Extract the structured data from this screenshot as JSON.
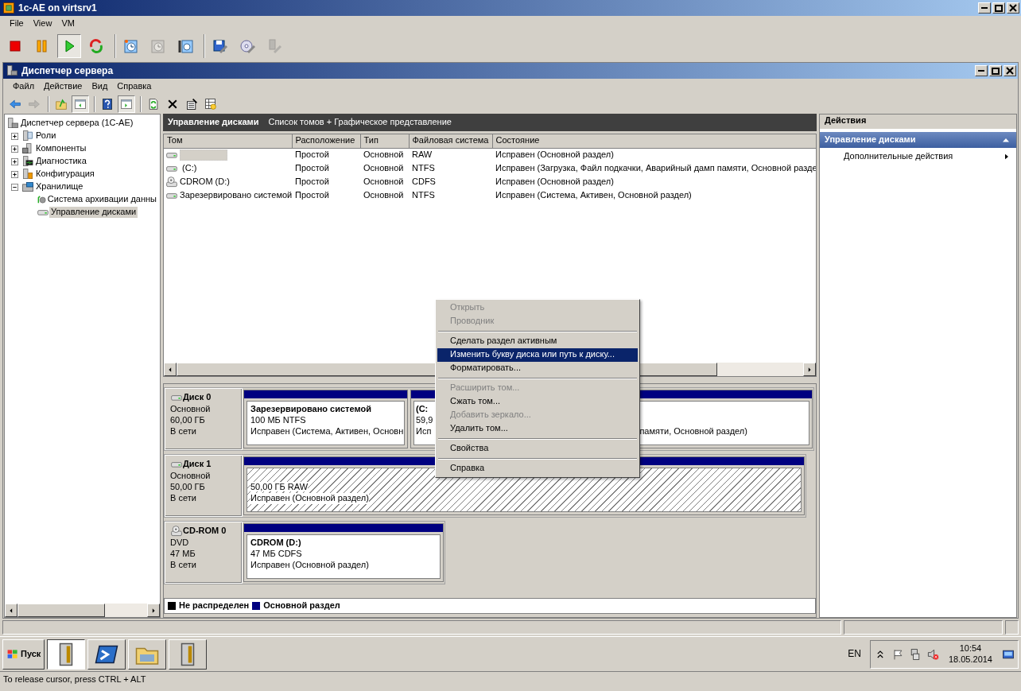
{
  "vm_window": {
    "title": "1c-AE on virtsrv1",
    "menu": [
      "File",
      "View",
      "VM"
    ],
    "toolbar": [
      {
        "kind": "stop",
        "disabled": false,
        "pressed": false
      },
      {
        "kind": "pause",
        "disabled": false,
        "pressed": false
      },
      {
        "kind": "play",
        "disabled": false,
        "pressed": true
      },
      {
        "kind": "reset",
        "disabled": false,
        "pressed": false
      },
      {
        "kind": "separator"
      },
      {
        "kind": "snapshot",
        "disabled": false,
        "pressed": false
      },
      {
        "kind": "revert",
        "disabled": true,
        "pressed": false
      },
      {
        "kind": "manage",
        "disabled": false,
        "pressed": false
      },
      {
        "kind": "separator"
      },
      {
        "kind": "floppy",
        "disabled": false,
        "pressed": false
      },
      {
        "kind": "cd",
        "disabled": false,
        "pressed": false
      },
      {
        "kind": "usb",
        "disabled": true,
        "pressed": false
      }
    ],
    "status_bar": "To release cursor, press CTRL + ALT"
  },
  "app_window": {
    "title": "Диспетчер сервера",
    "menu": [
      "Файл",
      "Действие",
      "Вид",
      "Справка"
    ],
    "toolbar": [
      {
        "kind": "back",
        "disabled": false,
        "pressed": false
      },
      {
        "kind": "forward",
        "disabled": true,
        "pressed": false
      },
      {
        "kind": "separator"
      },
      {
        "kind": "up",
        "disabled": false,
        "pressed": false
      },
      {
        "kind": "tree",
        "disabled": false,
        "pressed": true
      },
      {
        "kind": "separator"
      },
      {
        "kind": "help",
        "disabled": false,
        "pressed": false
      },
      {
        "kind": "actions",
        "disabled": false,
        "pressed": true
      },
      {
        "kind": "separator"
      },
      {
        "kind": "refresh",
        "disabled": false,
        "pressed": false
      },
      {
        "kind": "delete",
        "disabled": false,
        "pressed": false
      },
      {
        "kind": "properties",
        "disabled": false,
        "pressed": false
      },
      {
        "kind": "settings",
        "disabled": false,
        "pressed": false
      }
    ]
  },
  "tree": [
    {
      "label": "Диспетчер сервера (1C-AE)",
      "kind": "server",
      "selected": false,
      "children": [
        {
          "label": "Роли",
          "kind": "roles",
          "expanded": false,
          "selected": false
        },
        {
          "label": "Компоненты",
          "kind": "features",
          "expanded": false,
          "selected": false
        },
        {
          "label": "Диагностика",
          "kind": "diagnostics",
          "expanded": false,
          "selected": false
        },
        {
          "label": "Конфигурация",
          "kind": "config",
          "expanded": false,
          "selected": false
        },
        {
          "label": "Хранилище",
          "kind": "storage",
          "expanded": true,
          "selected": false,
          "children": [
            {
              "label": "Система архивации данны",
              "kind": "backup",
              "selected": false
            },
            {
              "label": "Управление дисками",
              "kind": "disk",
              "selected": true
            }
          ]
        }
      ]
    }
  ],
  "center": {
    "title": "Управление дисками",
    "subtitle": "Список томов + Графическое представление",
    "table": {
      "columns": [
        "Том",
        "Расположение",
        "Тип",
        "Файловая система",
        "Состояние"
      ],
      "rows": [
        {
          "kind": "disk",
          "selected": true,
          "cells": [
            "",
            "Простой",
            "Основной",
            "RAW",
            "Исправен (Основной раздел)"
          ]
        },
        {
          "kind": "disk",
          "selected": false,
          "cells": [
            " (C:)",
            "Простой",
            "Основной",
            "NTFS",
            "Исправен (Загрузка, Файл подкачки, Аварийный дамп памяти, Основной разде"
          ]
        },
        {
          "kind": "cdrom",
          "selected": false,
          "cells": [
            "CDROM (D:)",
            "Простой",
            "Основной",
            "CDFS",
            "Исправен (Основной раздел)"
          ]
        },
        {
          "kind": "disk",
          "selected": false,
          "cells": [
            "Зарезервировано системой",
            "Простой",
            "Основной",
            "NTFS",
            "Исправен (Система, Активен, Основной раздел)"
          ]
        }
      ]
    },
    "disks": [
      {
        "kind": "disk",
        "name": "Диск 0",
        "type": "Основной",
        "size": "60,00 ГБ",
        "status": "В сети",
        "partitions": [
          {
            "name": "Зарезервировано системой",
            "size_fs": "100 МБ NTFS",
            "status": "Исправен (Система, Активен, Основн",
            "selected": false
          },
          {
            "name": "(C:",
            "size_fs": "59,9",
            "status": "Исп",
            "status_tail": "памяти, Основной раздел)",
            "selected": false
          }
        ]
      },
      {
        "kind": "disk",
        "name": "Диск 1",
        "type": "Основной",
        "size": "50,00 ГБ",
        "status": "В сети",
        "partitions": [
          {
            "size_fs": "50,00 ГБ RAW",
            "status": "Исправен (Основной раздел)",
            "selected": true
          }
        ]
      },
      {
        "kind": "cdrom",
        "name": "CD-ROM 0",
        "type": "DVD",
        "size": "47 МБ",
        "status": "В сети",
        "partitions": [
          {
            "name": "CDROM  (D:)",
            "size_fs": "47 МБ CDFS",
            "status": "Исправен (Основной раздел)",
            "selected": false
          }
        ]
      }
    ],
    "legend": [
      {
        "label": "Не распределен",
        "color": "#000000"
      },
      {
        "label": "Основной раздел",
        "color": "#000080"
      }
    ]
  },
  "actions": {
    "title": "Действия",
    "sections": [
      {
        "title": "Управление дисками",
        "expanded": true,
        "items": [
          {
            "label": "Дополнительные действия",
            "submenu": true
          }
        ]
      }
    ]
  },
  "context_menu": [
    {
      "kind": "item",
      "label": "Открыть",
      "disabled": true,
      "selected": false
    },
    {
      "kind": "item",
      "label": "Проводник",
      "disabled": true,
      "selected": false
    },
    {
      "kind": "separator"
    },
    {
      "kind": "item",
      "label": "Сделать раздел активным",
      "disabled": false,
      "selected": false
    },
    {
      "kind": "item",
      "label": "Изменить букву диска или путь к диску...",
      "disabled": false,
      "selected": true
    },
    {
      "kind": "item",
      "label": "Форматировать...",
      "disabled": false,
      "selected": false
    },
    {
      "kind": "separator"
    },
    {
      "kind": "item",
      "label": "Расширить том...",
      "disabled": true,
      "selected": false
    },
    {
      "kind": "item",
      "label": "Сжать том...",
      "disabled": false,
      "selected": false
    },
    {
      "kind": "item",
      "label": "Добавить зеркало...",
      "disabled": true,
      "selected": false
    },
    {
      "kind": "item",
      "label": "Удалить том...",
      "disabled": false,
      "selected": false
    },
    {
      "kind": "separator"
    },
    {
      "kind": "item",
      "label": "Свойства",
      "disabled": false,
      "selected": false
    },
    {
      "kind": "separator"
    },
    {
      "kind": "item",
      "label": "Справка",
      "disabled": false,
      "selected": false
    }
  ],
  "taskbar": {
    "start": "Пуск",
    "apps": [
      {
        "kind": "server",
        "selected": true
      },
      {
        "kind": "powershell",
        "selected": false
      },
      {
        "kind": "explorer",
        "selected": false
      },
      {
        "kind": "tools",
        "selected": false
      }
    ],
    "language": "EN",
    "time": "10:54",
    "date": "18.05.2014"
  }
}
